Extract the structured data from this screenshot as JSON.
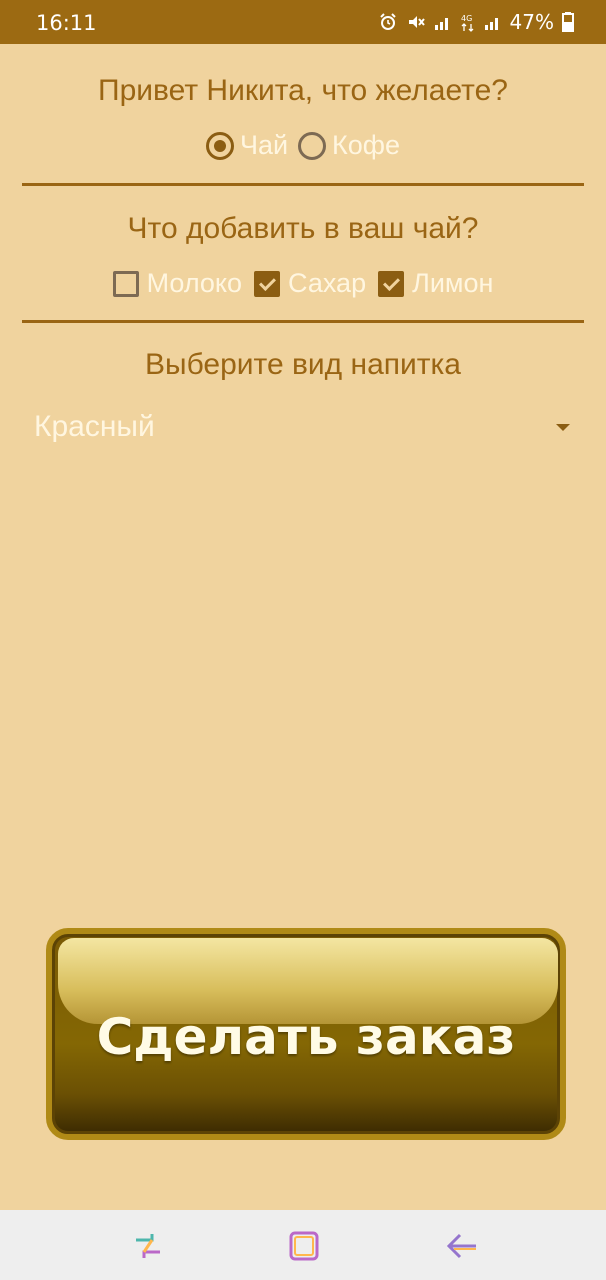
{
  "status_bar": {
    "time": "16:11",
    "battery": "47%",
    "network": "4G"
  },
  "greeting": "Привет Никита, что желаете?",
  "drink_choice": {
    "options": [
      {
        "label": "Чай",
        "checked": true
      },
      {
        "label": "Кофе",
        "checked": false
      }
    ]
  },
  "addons": {
    "question": "Что добавить в ваш чай?",
    "options": [
      {
        "label": "Молоко",
        "checked": false
      },
      {
        "label": "Сахар",
        "checked": true
      },
      {
        "label": "Лимон",
        "checked": true
      }
    ]
  },
  "drink_type": {
    "label": "Выберите вид напитка",
    "selected": "Красный"
  },
  "order_button": {
    "label": "Сделать заказ"
  },
  "nav_bar": {
    "icons": [
      "recent-apps-icon",
      "home-icon",
      "back-icon"
    ]
  },
  "colors": {
    "background": "#f0d39e",
    "status_bar": "#9c6a12",
    "accent_text": "#9a6514",
    "button_gold": "#846704"
  }
}
